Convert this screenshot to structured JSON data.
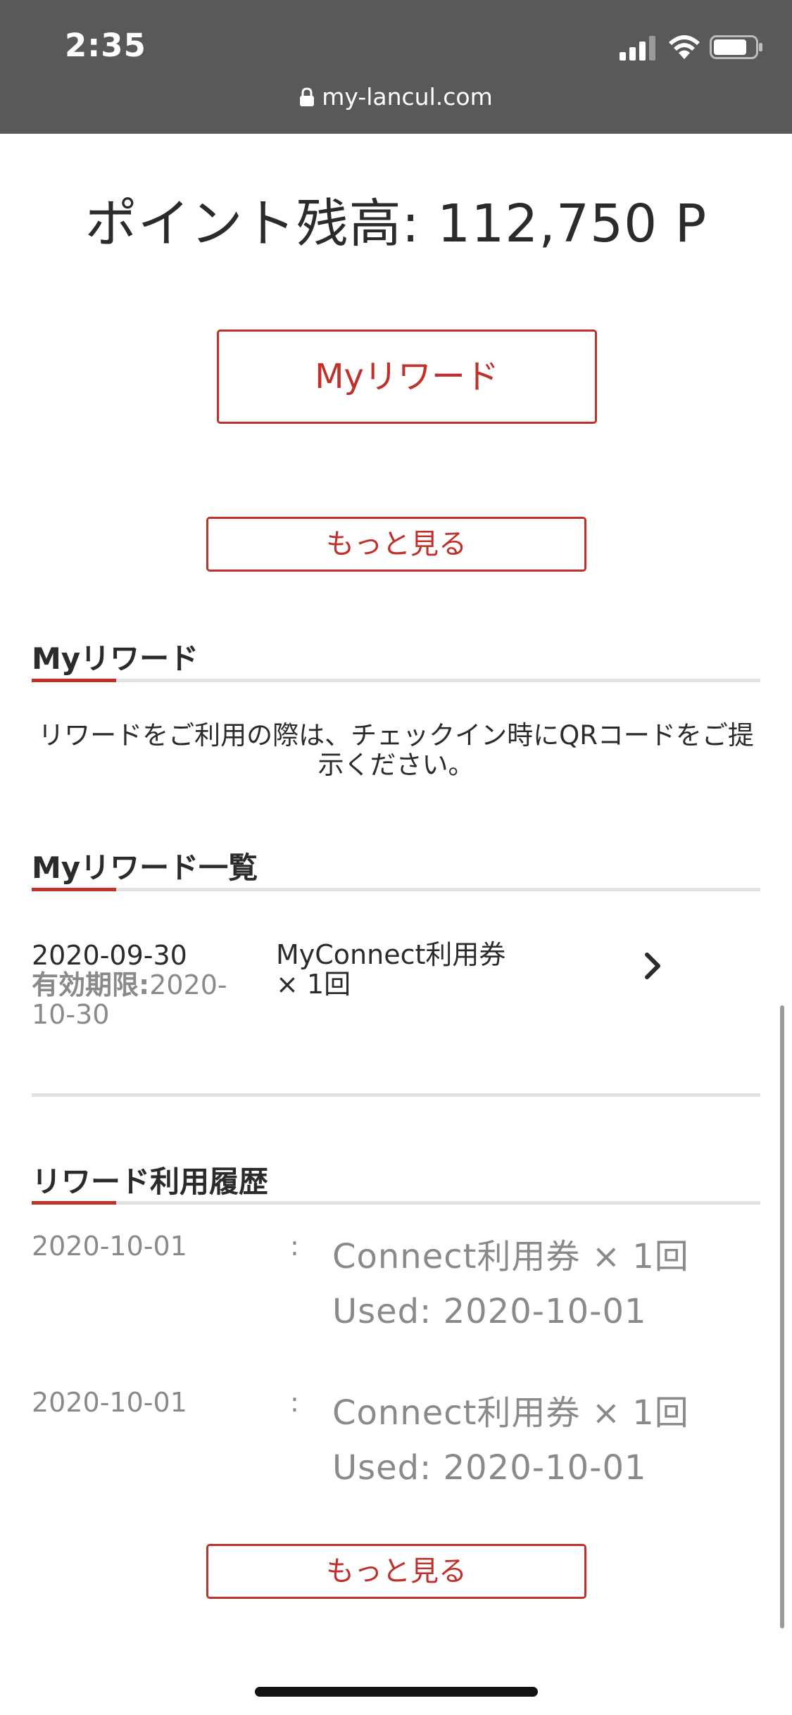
{
  "status_bar": {
    "time": "2:35",
    "url": "my-lancul.com"
  },
  "balance": {
    "text": "ポイント残高: 112,750 P"
  },
  "buttons": {
    "my_rewards": "Myリワード",
    "more_1": "もっと見る",
    "more_2": "もっと見る"
  },
  "sections": {
    "my_rewards_title": "Myリワード",
    "notice": "リワードをご利用の際は、チェックイン時にQRコードをご提示ください。",
    "reward_list_title": "Myリワード一覧",
    "history_title": "リワード利用履歴"
  },
  "reward_list": [
    {
      "date": "2020-09-30",
      "expiry_label": "有効期限:",
      "expiry_date": "2020-10-30",
      "name": "MyConnect利用券 × 1回"
    }
  ],
  "history": [
    {
      "date": "2020-10-01",
      "separator": ":",
      "item": "Connect利用券 × 1回",
      "used": "Used: 2020-10-01"
    },
    {
      "date": "2020-10-01",
      "separator": ":",
      "item": "Connect利用券 × 1回",
      "used": "Used: 2020-10-01"
    }
  ],
  "colors": {
    "accent": "#c0312b",
    "topbar": "#595959",
    "muted_text": "#8a8a8a"
  }
}
